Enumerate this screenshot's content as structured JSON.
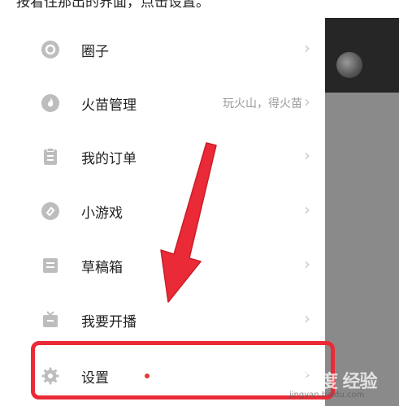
{
  "caption": "按看住那出的界面，点击设置。",
  "menu": {
    "items": [
      {
        "label": "圈子",
        "sub": ""
      },
      {
        "label": "火苗管理",
        "sub": "玩火山，得火苗"
      },
      {
        "label": "我的订单",
        "sub": ""
      },
      {
        "label": "小游戏",
        "sub": ""
      },
      {
        "label": "草稿箱",
        "sub": ""
      },
      {
        "label": "我要开播",
        "sub": ""
      },
      {
        "label": "设置",
        "sub": ""
      }
    ],
    "chevron": "›"
  },
  "watermark": {
    "brand": "Bai 百度 经验",
    "url": "jingyan.baidu.com"
  },
  "colors": {
    "highlight": "#ea2a36",
    "arrow": "#ea2a36",
    "icon": "#bdbdbd",
    "notification_dot": "#e23a35"
  },
  "icons": [
    "circle-icon",
    "flame-icon",
    "clipboard-icon",
    "game-icon",
    "draft-box-icon",
    "live-tv-icon",
    "gear-icon"
  ]
}
